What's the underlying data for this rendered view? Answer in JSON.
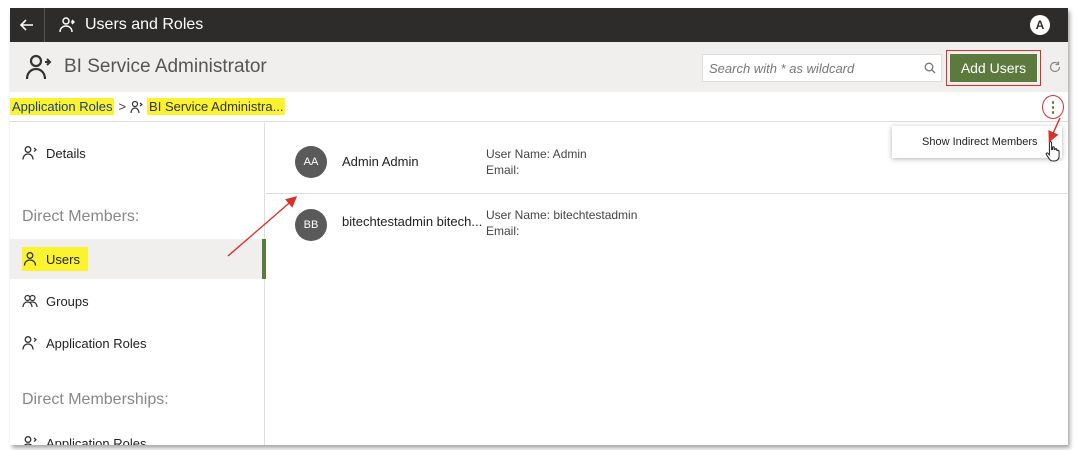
{
  "topbar": {
    "title": "Users and Roles",
    "avatar": "A"
  },
  "header": {
    "title": "BI Service Administrator",
    "search_placeholder": "Search with * as wildcard",
    "add_label": "Add Users"
  },
  "breadcrumb": {
    "root": "Application Roles",
    "separator": ">",
    "current": "BI Service Administra..."
  },
  "menu": {
    "show_indirect": "Show Indirect Members"
  },
  "sidebar": {
    "details": "Details",
    "direct_members": "Direct Members:",
    "users": "Users",
    "groups": "Groups",
    "app_roles": "Application Roles",
    "direct_memberships": "Direct Memberships:",
    "app_roles_2": "Application Roles"
  },
  "members": [
    {
      "initials": "AA",
      "name": "Admin Admin",
      "user_line": "User Name: Admin",
      "email_line": "Email:"
    },
    {
      "initials": "BB",
      "name": "bitechtestadmin bitech...",
      "user_line": "User Name: bitechtestadmin",
      "email_line": "Email:"
    }
  ],
  "colors": {
    "accent": "#5c7a3e",
    "highlight": "#fbf230",
    "annotation": "#d9302a",
    "topbar": "#2e2c2a"
  }
}
